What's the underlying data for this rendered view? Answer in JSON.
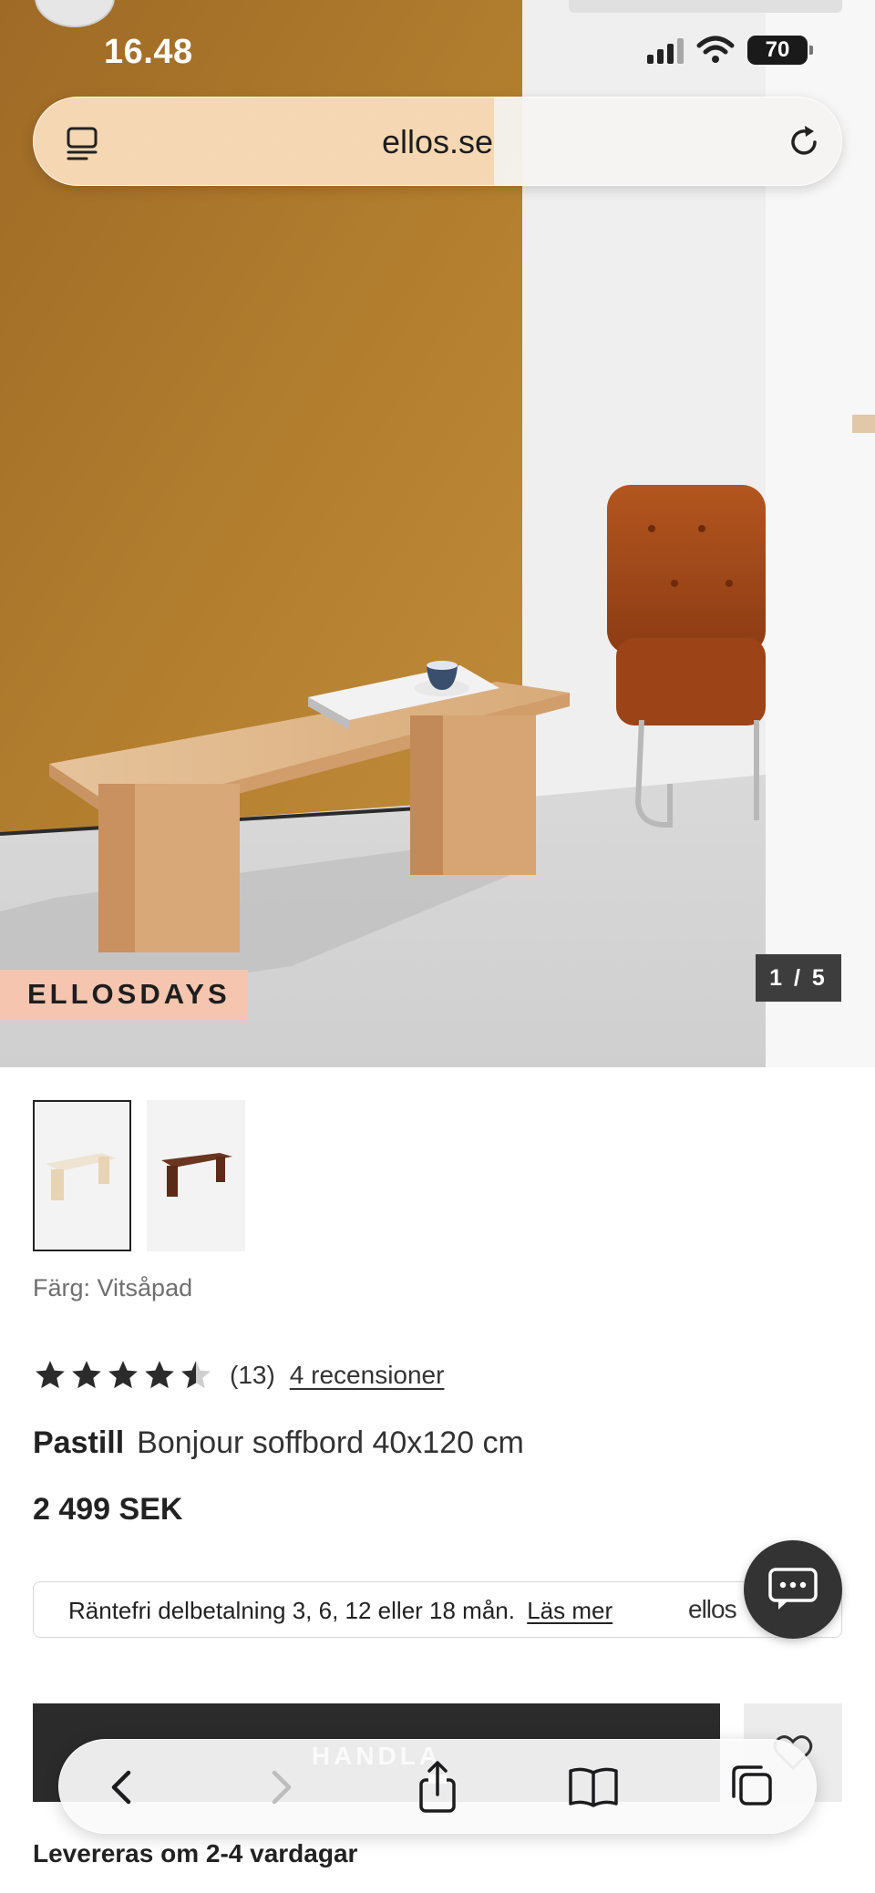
{
  "status_bar": {
    "time": "16.48",
    "battery": "70"
  },
  "address_bar": {
    "url": "ellos.se"
  },
  "gallery": {
    "badge": "ELLOSDAYS",
    "counter": "1 / 5"
  },
  "color": {
    "label": "Färg: Vitsåpad"
  },
  "rating": {
    "value": 4.5,
    "max": 5,
    "count": "(13)",
    "reviews_link": "4 recensioner"
  },
  "product": {
    "brand": "Pastill",
    "name": "Bonjour soffbord 40x120 cm",
    "price": "2 499 SEK"
  },
  "financing": {
    "text": "Räntefri delbetalning 3, 6, 12 eller 18 mån.",
    "link": "Läs mer",
    "logo": "ellos"
  },
  "cart": {
    "label": "HANDLA"
  },
  "delivery": {
    "text": "Levereras om 2-4 vardagar"
  },
  "icons": {
    "address_menu": "address-bar-menu-icon",
    "reload": "reload-icon",
    "chat": "chat-icon",
    "wishlist": "heart-icon",
    "back": "chevron-left-icon",
    "forward": "chevron-right-icon",
    "share": "share-icon",
    "bookmarks": "book-icon",
    "tabs": "tabs-icon"
  },
  "colors": {
    "accent_dark": "#2b2b2b",
    "badge_bg": "#f5c5b0",
    "wall_ochre": "#b07a2e",
    "chair_rust": "#a24a1c",
    "bench_wood": "#dbb58a"
  }
}
